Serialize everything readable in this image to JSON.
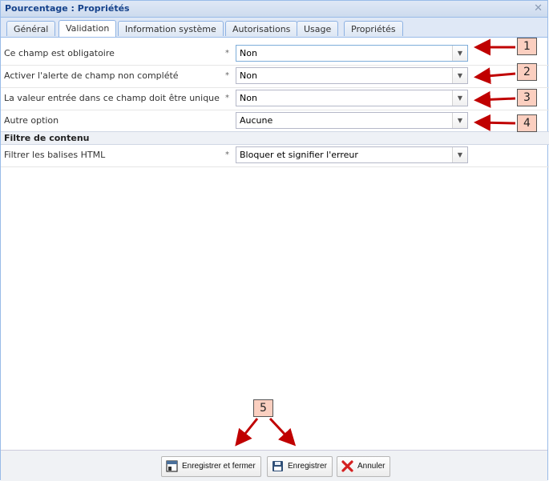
{
  "window": {
    "title": "Pourcentage : Propriétés"
  },
  "tabs": [
    {
      "label": "Général"
    },
    {
      "label": "Validation"
    },
    {
      "label": "Information système"
    },
    {
      "label": "Autorisations"
    },
    {
      "label": "Usage"
    },
    {
      "label": "Propriétés"
    }
  ],
  "fields": [
    {
      "label": "Ce champ est obligatoire",
      "required": "*",
      "value": "Non"
    },
    {
      "label": "Activer l'alerte de champ non complété",
      "required": "*",
      "value": "Non"
    },
    {
      "label": "La valeur entrée dans ce champ doit être unique",
      "required": "*",
      "value": "Non"
    },
    {
      "label": "Autre option",
      "required": "",
      "value": "Aucune"
    }
  ],
  "section": {
    "title": "Filtre de contenu"
  },
  "filter_field": {
    "label": "Filtrer les balises HTML",
    "required": "*",
    "value": "Bloquer et signifier l'erreur"
  },
  "badges": [
    "1",
    "2",
    "3",
    "4",
    "5"
  ],
  "footer": {
    "save_close": "Enregistrer et fermer",
    "save": "Enregistrer",
    "cancel": "Annuler"
  },
  "colors": {
    "arrow": "#c00000",
    "badge_bg": "#fbcfc0",
    "accent": "#15428b"
  }
}
